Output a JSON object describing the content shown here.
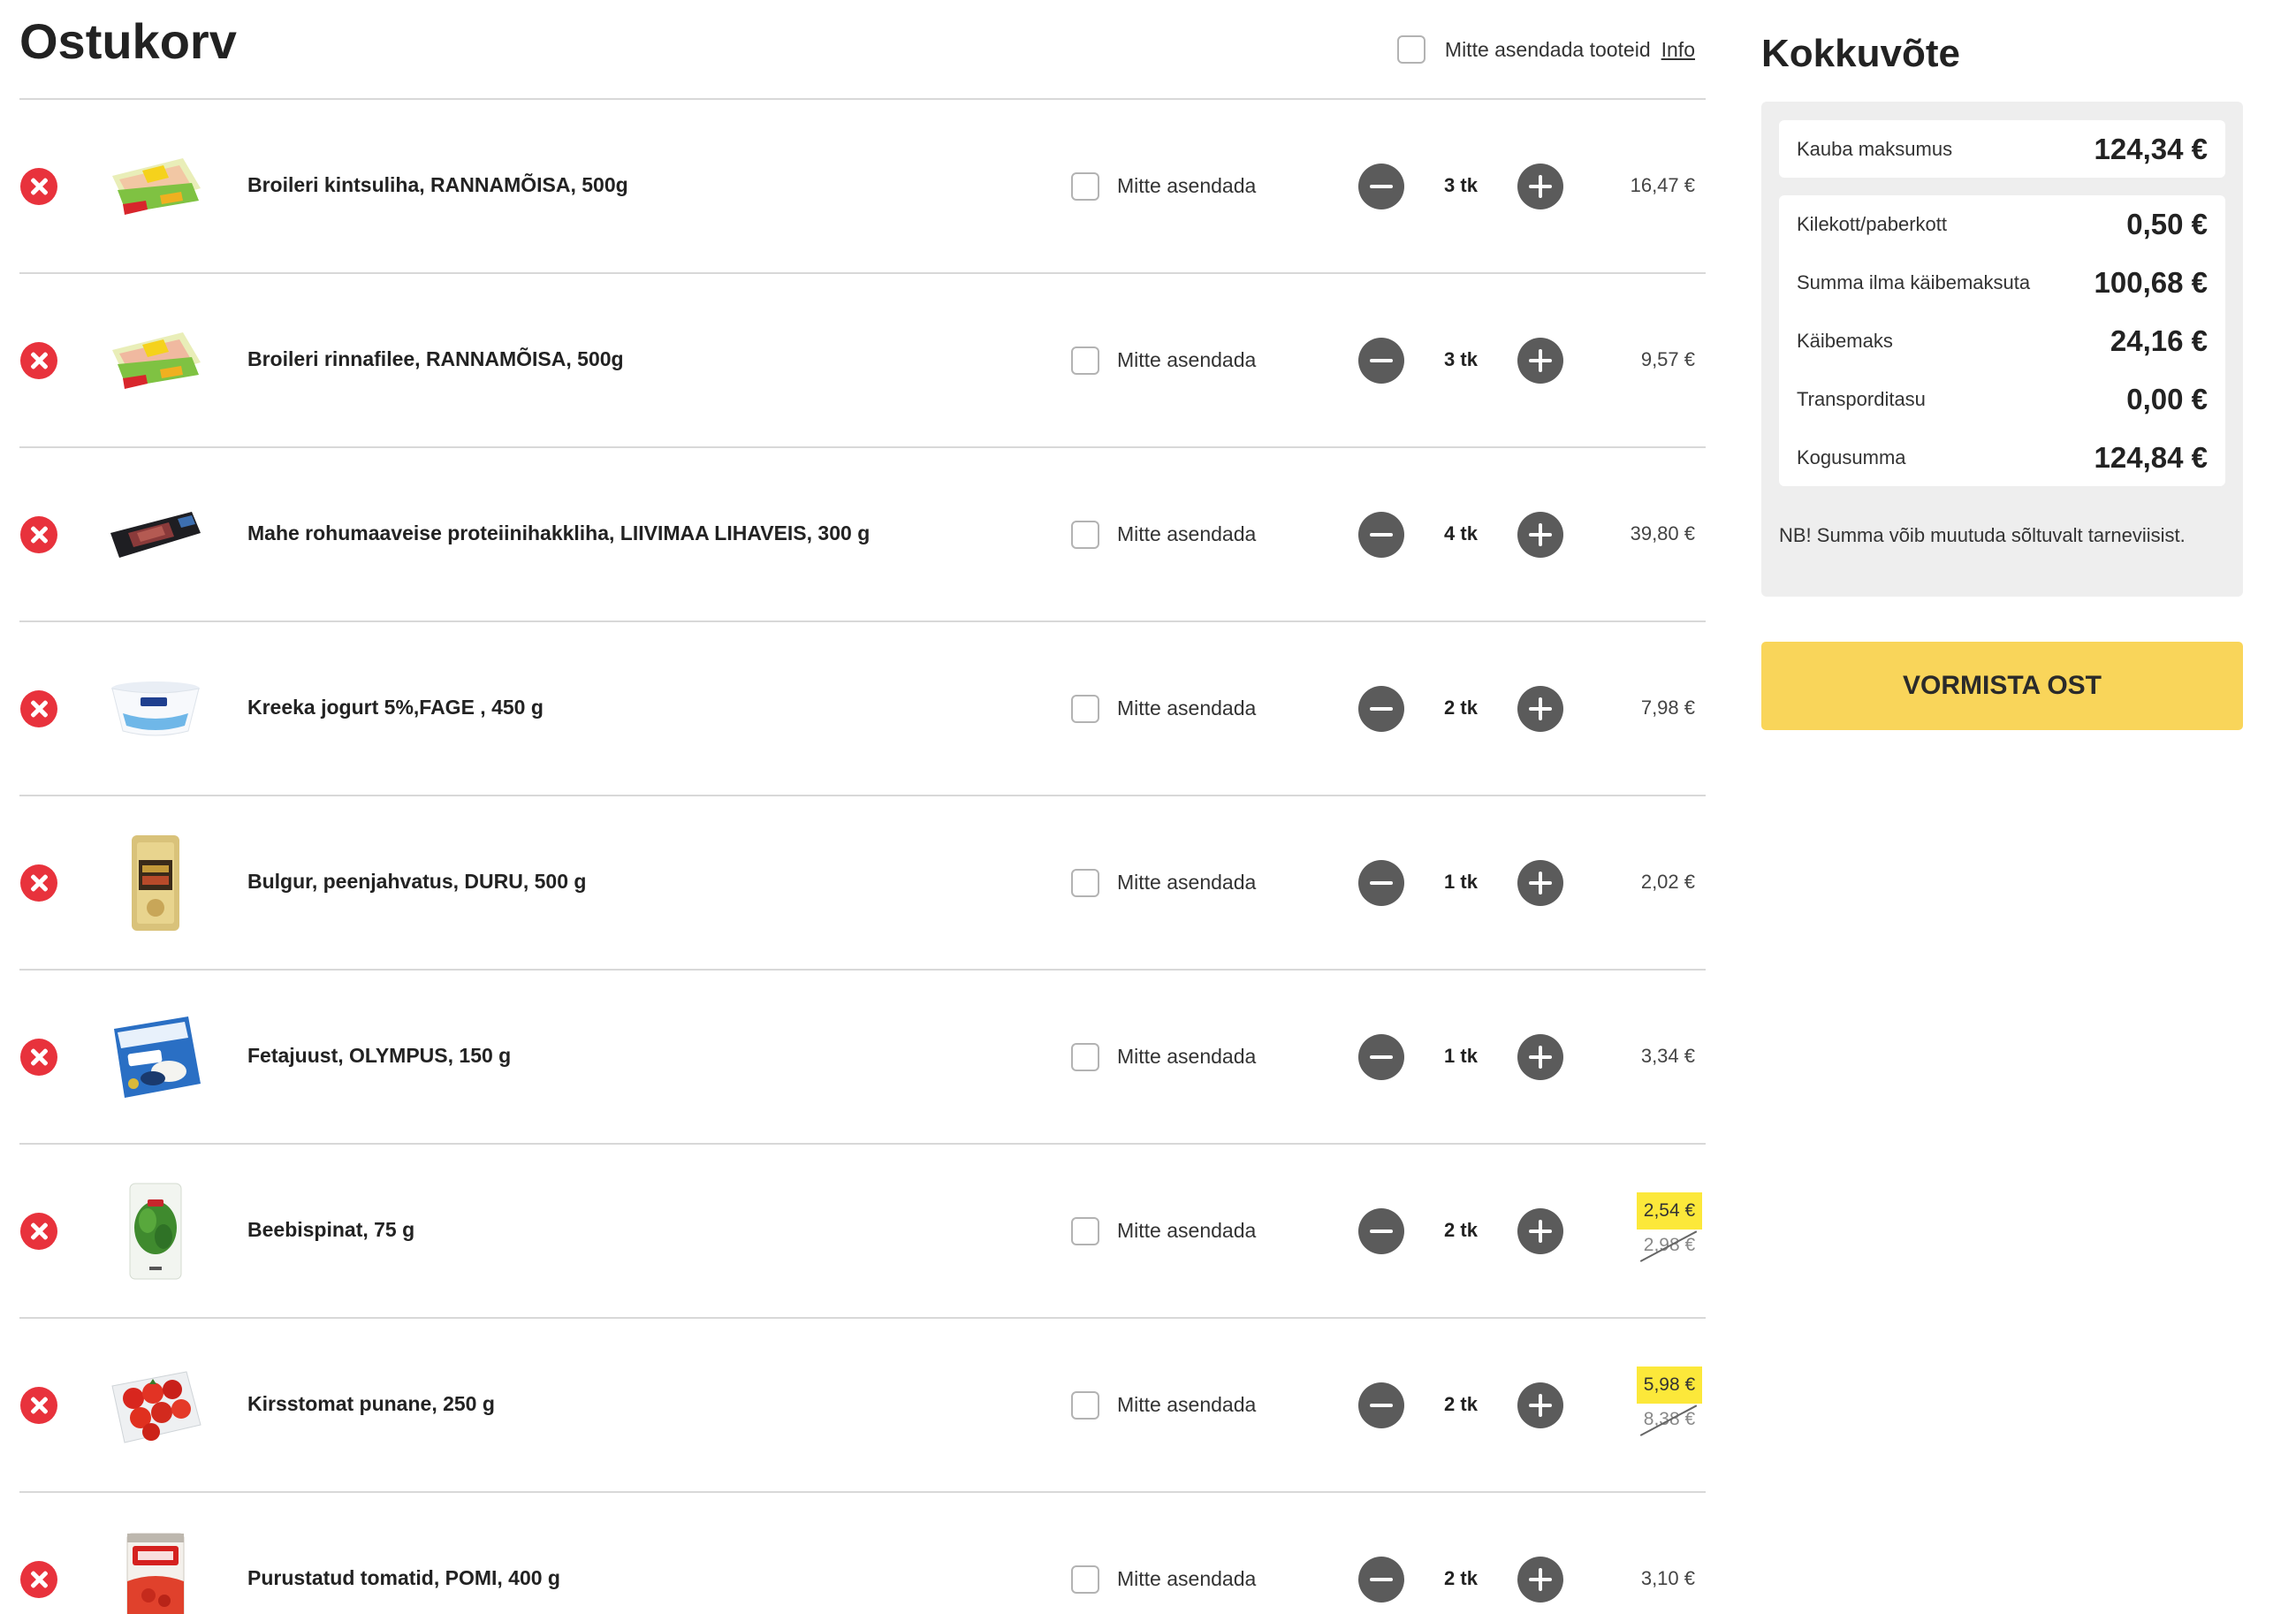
{
  "cart": {
    "title": "Ostukorv",
    "no_substitute_all_label": "Mitte asendada tooteid",
    "info_link": "Info",
    "items": [
      {
        "name": "Broileri kintsuliha, RANNAMÕISA, 500g",
        "substitute_label": "Mitte asendada",
        "qty": "3 tk",
        "price": "16,47 €",
        "image": "chicken-package-icon"
      },
      {
        "name": "Broileri rinnafilee, RANNAMÕISA, 500g",
        "substitute_label": "Mitte asendada",
        "qty": "3 tk",
        "price": "9,57 €",
        "image": "chicken-package-icon"
      },
      {
        "name": "Mahe rohumaaveise proteiinihakkliha, LIIVIMAA LIHAVEIS, 300 g",
        "substitute_label": "Mitte asendada",
        "qty": "4 tk",
        "price": "39,80 €",
        "image": "minced-meat-package-icon"
      },
      {
        "name": "Kreeka jogurt 5%,FAGE , 450 g",
        "substitute_label": "Mitte asendada",
        "qty": "2 tk",
        "price": "7,98 €",
        "image": "yogurt-tub-icon"
      },
      {
        "name": "Bulgur, peenjahvatus, DURU, 500 g",
        "substitute_label": "Mitte asendada",
        "qty": "1 tk",
        "price": "2,02 €",
        "image": "bulgur-bag-icon"
      },
      {
        "name": "Fetajuust, OLYMPUS, 150 g",
        "substitute_label": "Mitte asendada",
        "qty": "1 tk",
        "price": "3,34 €",
        "image": "feta-package-icon"
      },
      {
        "name": "Beebispinat, 75 g",
        "substitute_label": "Mitte asendada",
        "qty": "2 tk",
        "price": "2,54 €",
        "old_price": "2,98 €",
        "image": "spinach-bag-icon"
      },
      {
        "name": "Kirsstomat punane, 250 g",
        "substitute_label": "Mitte asendada",
        "qty": "2 tk",
        "price": "5,98 €",
        "old_price": "8,38 €",
        "image": "cherry-tomato-box-icon"
      },
      {
        "name": "Purustatud tomatid, POMI, 400 g",
        "substitute_label": "Mitte asendada",
        "qty": "2 tk",
        "price": "3,10 €",
        "image": "tomato-can-icon"
      }
    ]
  },
  "summary": {
    "title": "Kokkuvõte",
    "goods_label": "Kauba maksumus",
    "goods_value": "124,34 €",
    "rows": [
      {
        "label": "Kilekott/paberkott",
        "value": "0,50 €"
      },
      {
        "label": "Summa ilma käibemaksuta",
        "value": "100,68 €"
      },
      {
        "label": "Käibemaks",
        "value": "24,16 €"
      },
      {
        "label": "Transporditasu",
        "value": "0,00 €"
      },
      {
        "label": "Kogusumma",
        "value": "124,84 €"
      }
    ],
    "note": "NB! Summa võib muutuda sõltuvalt tarneviisist.",
    "checkout_label": "VORMISTA OST"
  },
  "colors": {
    "remove": "#e8323c",
    "qty_button": "#5b5b5b",
    "sale_highlight": "#fce83a",
    "checkout_button": "#f9d55a",
    "summary_bg": "#eeeeee"
  }
}
